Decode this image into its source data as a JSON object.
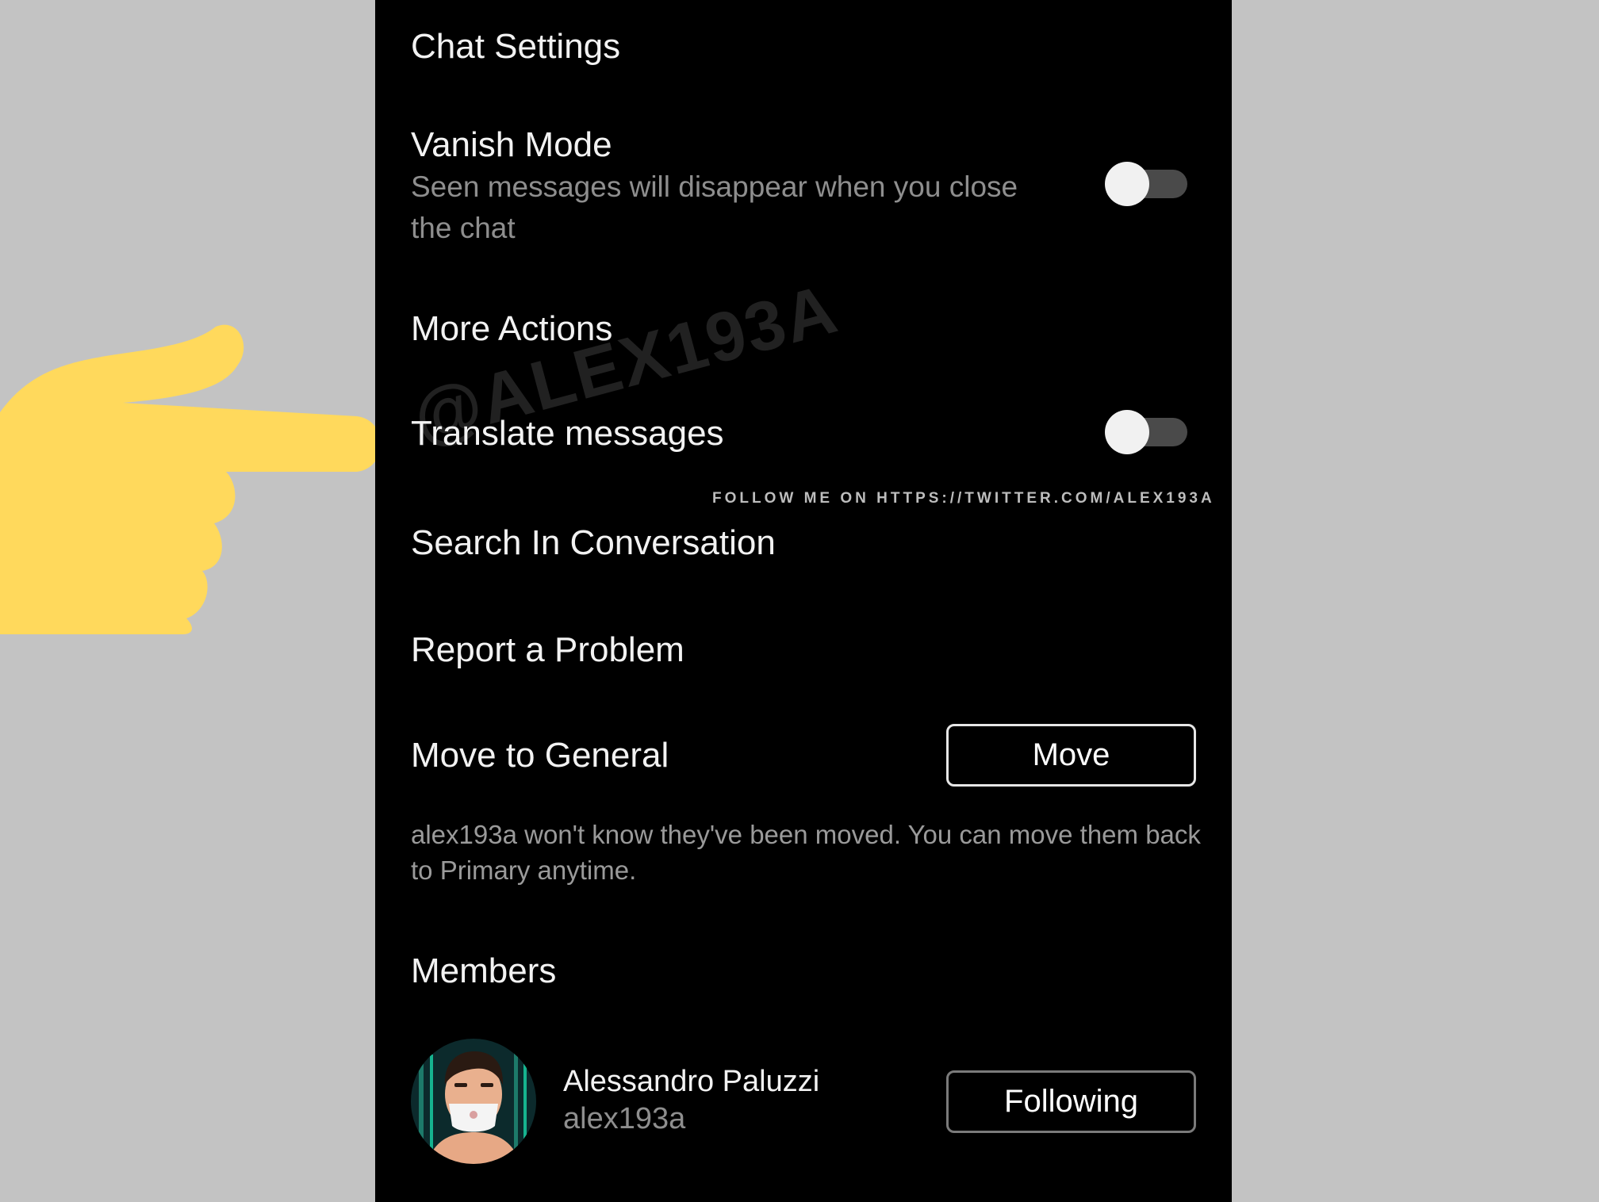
{
  "header": {
    "title": "Chat Settings"
  },
  "vanish_mode": {
    "title": "Vanish Mode",
    "description": "Seen messages will disappear when you close the chat",
    "enabled": false
  },
  "more_actions": {
    "title": "More Actions"
  },
  "translate": {
    "title": "Translate messages",
    "enabled": false
  },
  "search": {
    "title": "Search In Conversation"
  },
  "report": {
    "title": "Report a Problem"
  },
  "move_general": {
    "title": "Move to General",
    "button_label": "Move",
    "note": "alex193a won't know they've been moved. You can move them back to Primary anytime."
  },
  "members": {
    "title": "Members",
    "items": [
      {
        "name": "Alessandro Paluzzi",
        "username": "alex193a",
        "button_label": "Following"
      }
    ]
  },
  "overlay": {
    "watermark": "@ALEX193A",
    "follow_note": "FOLLOW ME ON HTTPS://TWITTER.COM/ALEX193A",
    "pointer_color": "#FFD95C"
  },
  "colors": {
    "background": "#000000",
    "side_background": "#c3c3c3",
    "secondary_text": "#8e8e8e"
  }
}
